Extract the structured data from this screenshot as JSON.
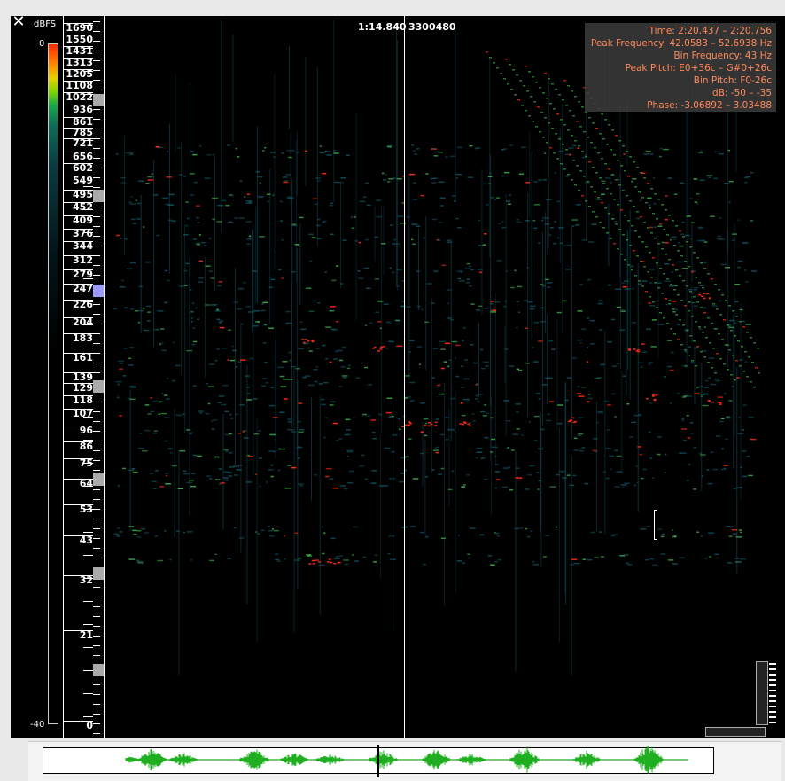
{
  "close_icon": "close-icon",
  "colorbar": {
    "unit": "dBFS",
    "max_label": "0",
    "min_label": "-40"
  },
  "frequency_scale": {
    "labels": [
      "1690",
      "1550",
      "1431",
      "1313",
      "1205",
      "1108",
      "1022",
      "936",
      "861",
      "785",
      "721",
      "656",
      "602",
      "549",
      "495",
      "452",
      "409",
      "376",
      "344",
      "312",
      "279",
      "247",
      "226",
      "204",
      "183",
      "161",
      "139",
      "129",
      "118",
      "107",
      "96",
      "86",
      "75",
      "64",
      "53",
      "43",
      "32",
      "21",
      "0"
    ]
  },
  "cursor": {
    "time": "1:14.840",
    "sample": "3300480"
  },
  "info": {
    "time": "Time: 2:20.437 – 2:20.756",
    "peak_frequency": "Peak Frequency: 42.0583 – 52.6938 Hz",
    "bin_frequency": "Bin Frequency: 43 Hz",
    "peak_pitch": "Peak Pitch: E0+36c – G#0+26c",
    "bin_pitch": "Bin Pitch: F0-26c",
    "db": "dB: -50 – -35",
    "phase": "Phase: -3.06892 – 3.03488"
  },
  "colors": {
    "info_text": "#ff8a5c",
    "waveform": "#1fae1f",
    "spectro_low": "#0e4a55",
    "spectro_mid": "#3aa24a",
    "spectro_high": "#ff2a10"
  }
}
